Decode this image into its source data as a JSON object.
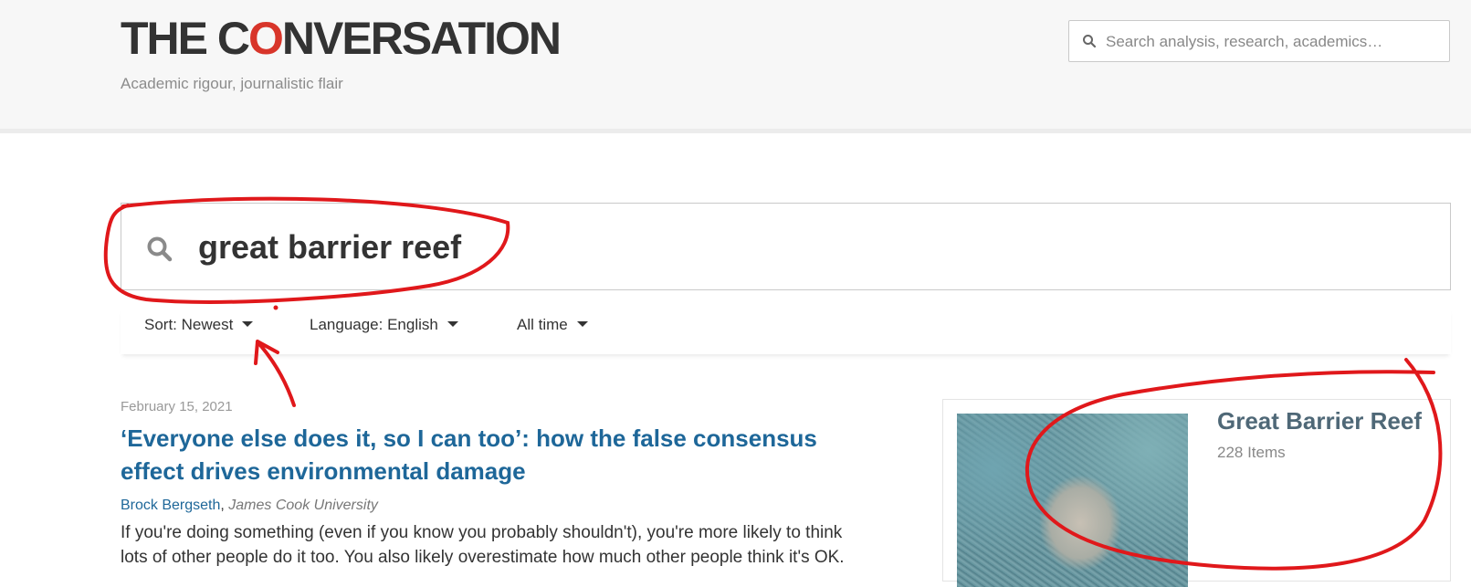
{
  "header": {
    "logo_parts": [
      "THE C",
      "O",
      "NVERSATION"
    ],
    "tagline": "Academic rigour, journalistic flair",
    "search_placeholder": "Search analysis, research, academics…"
  },
  "search": {
    "query": "great barrier reef"
  },
  "filters": {
    "sort_label": "Sort: Newest",
    "language_label": "Language: English",
    "time_label": "All time"
  },
  "article": {
    "date": "February 15, 2021",
    "title": "‘Everyone else does it, so I can too’: how the false consensus effect drives environmental damage",
    "author": "Brock Bergseth",
    "separator": ", ",
    "affiliation": "James Cook University",
    "excerpt": "If you're doing something (even if you know you probably shouldn't), you're more likely to think lots of other people do it too. You also likely overestimate how much other people think it's OK."
  },
  "topic": {
    "title": "Great Barrier Reef",
    "count": "228 Items"
  },
  "colors": {
    "brand_red": "#d8352a",
    "link_blue": "#1e6799",
    "annotation_red": "#e0181b"
  },
  "icons": [
    "search-icon",
    "caret-down-icon"
  ]
}
